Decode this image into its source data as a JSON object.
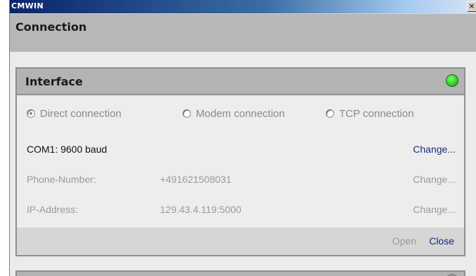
{
  "window": {
    "title": "CMWIN",
    "close_label": "×"
  },
  "section": {
    "title": "Connection"
  },
  "interface_panel": {
    "title": "Interface",
    "status_color": "#2fd12a",
    "radios": [
      {
        "label": "Direct connection",
        "checked": true
      },
      {
        "label": "Modem connection",
        "checked": false
      },
      {
        "label": "TCP connection",
        "checked": false
      }
    ],
    "com": {
      "label": "COM1: 9600 baud",
      "action": "Change..."
    },
    "phone": {
      "label": "Phone-Number:",
      "value": "+491621508031",
      "action": "Change..."
    },
    "ip": {
      "label": "IP-Address:",
      "value": "129.43.4.119:5000",
      "action": "Change..."
    },
    "footer": {
      "open_label": "Open",
      "close_label": "Close"
    }
  }
}
